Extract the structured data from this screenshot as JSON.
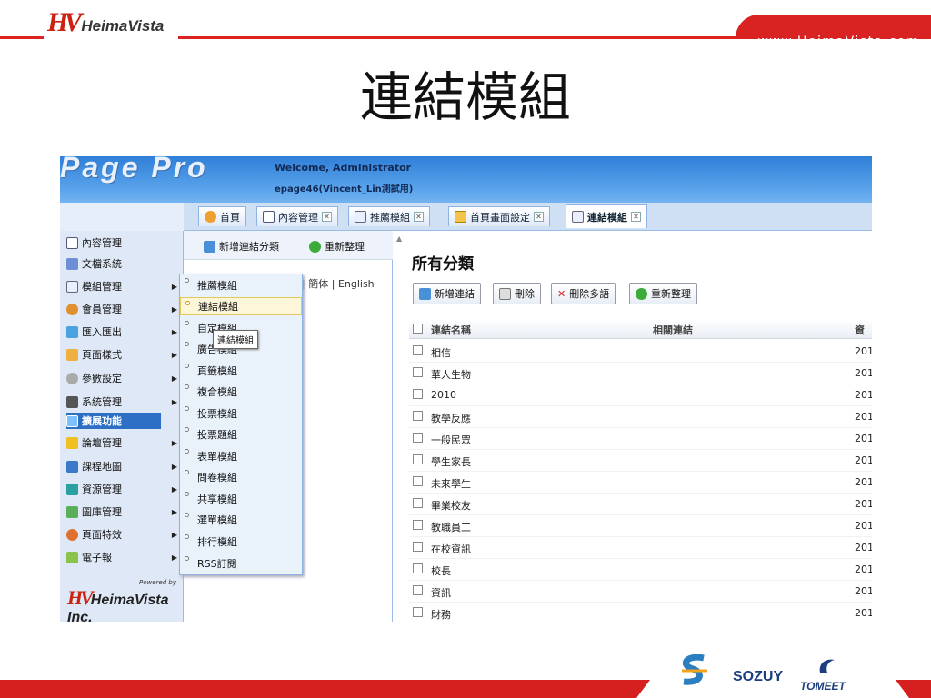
{
  "slide": {
    "logo_text": "HeimaVista",
    "url": "www.HeimaVista.com",
    "title": "連結模組"
  },
  "app": {
    "logo": "Page Pro",
    "welcome": "Welcome, Administrator",
    "site": "epage46(Vincent_Lin測試用)",
    "tabs": [
      {
        "label": "首頁",
        "icon": "home-icon"
      },
      {
        "label": "內容管理",
        "icon": "content-icon"
      },
      {
        "label": "推薦模組",
        "icon": "doc-icon"
      },
      {
        "label": "首頁畫面設定",
        "icon": "layout-icon"
      },
      {
        "label": "連結模組",
        "icon": "link-doc-icon"
      }
    ],
    "sidebar": [
      {
        "label": "內容管理",
        "icon": "content-icon"
      },
      {
        "label": "文檔系統",
        "icon": "doc-system-icon"
      },
      {
        "label": "模組管理",
        "icon": "module-icon"
      },
      {
        "label": "會員管理",
        "icon": "member-icon"
      },
      {
        "label": "匯入匯出",
        "icon": "import-export-icon"
      },
      {
        "label": "頁面樣式",
        "icon": "style-icon"
      },
      {
        "label": "參數設定",
        "icon": "gear-icon"
      },
      {
        "label": "系統管理",
        "icon": "system-icon"
      },
      {
        "label": "擴展功能",
        "icon": "extend-icon"
      },
      {
        "label": "論壇管理",
        "icon": "forum-icon"
      },
      {
        "label": "課程地圖",
        "icon": "course-icon"
      },
      {
        "label": "資源管理",
        "icon": "resource-icon"
      },
      {
        "label": "圖庫管理",
        "icon": "gallery-icon"
      },
      {
        "label": "頁面特效",
        "icon": "effect-icon"
      },
      {
        "label": "電子報",
        "icon": "newsletter-icon"
      }
    ],
    "powered_by": "Powered by",
    "powered_logo": "HeimaVista Inc.",
    "mid": {
      "add_category": "新增連結分類",
      "refresh": "重新整理",
      "lang_simplified": "簡体",
      "lang_english": "English",
      "separator": "|"
    },
    "submenu": [
      "推薦模組",
      "連結模組",
      "自定模組",
      "廣告模組",
      "頁籤模組",
      "複合模組",
      "投票模組",
      "投票題組",
      "表單模組",
      "問卷模組",
      "共享模組",
      "選單模組",
      "排行模組",
      "RSS訂閱"
    ],
    "tooltip": "連結模組",
    "main": {
      "title": "所有分類",
      "buttons": [
        "新增連結",
        "刪除",
        "刪除多語",
        "重新整理"
      ],
      "columns": [
        "連結名稱",
        "相關連結",
        "資"
      ],
      "rows": [
        {
          "name": "相信",
          "date": "201"
        },
        {
          "name": "華人生物",
          "date": "201"
        },
        {
          "name": "2010",
          "date": "201"
        },
        {
          "name": "教學反應",
          "date": "201"
        },
        {
          "name": "一般民眾",
          "date": "201"
        },
        {
          "name": "學生家長",
          "date": "201"
        },
        {
          "name": "未來學生",
          "date": "201"
        },
        {
          "name": "畢業校友",
          "date": "201"
        },
        {
          "name": "教職員工",
          "date": "201"
        },
        {
          "name": "在校資訊",
          "date": "201"
        },
        {
          "name": "校長",
          "date": "201"
        },
        {
          "name": "資訊",
          "date": "201"
        },
        {
          "name": "財務",
          "date": "201"
        }
      ]
    }
  },
  "footer_brands": [
    "SOZUY",
    "TOMEET"
  ]
}
